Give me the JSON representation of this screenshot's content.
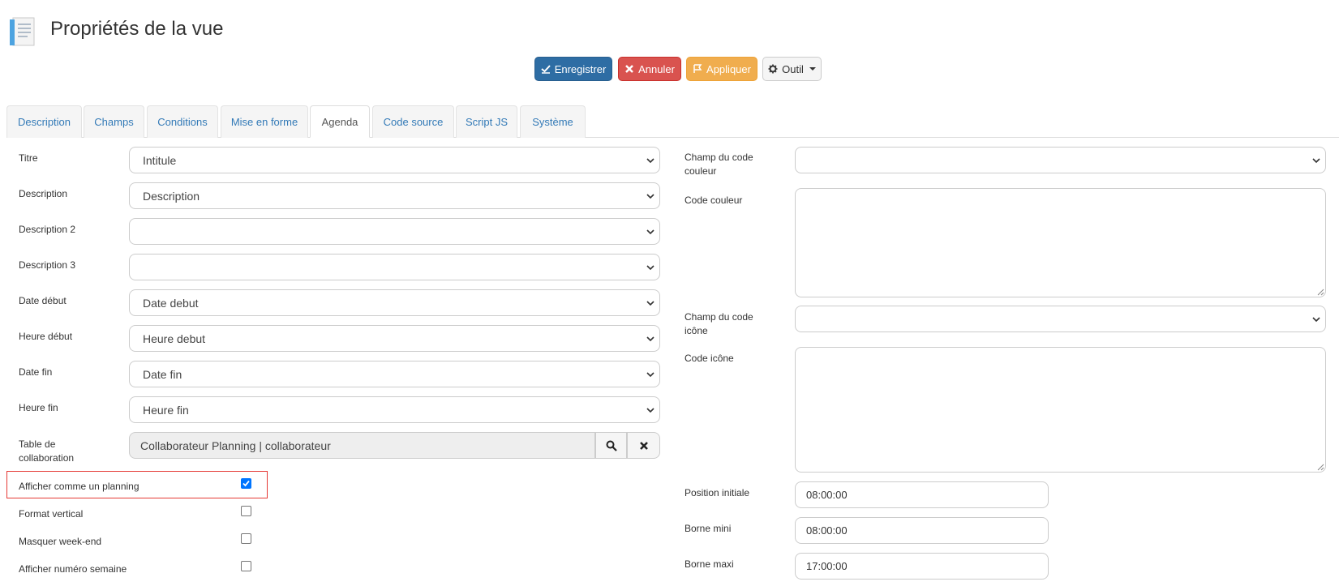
{
  "page": {
    "title": "Propriétés de la vue"
  },
  "toolbar": {
    "save_label": "Enregistrer",
    "cancel_label": "Annuler",
    "apply_label": "Appliquer",
    "tools_label": "Outil"
  },
  "tabs": [
    {
      "label": "Description",
      "active": false
    },
    {
      "label": "Champs",
      "active": false
    },
    {
      "label": "Conditions",
      "active": false
    },
    {
      "label": "Mise en forme",
      "active": false
    },
    {
      "label": "Agenda",
      "active": true
    },
    {
      "label": "Code source",
      "active": false
    },
    {
      "label": "Script JS",
      "active": false
    },
    {
      "label": "Système",
      "active": false
    }
  ],
  "left_fields": {
    "titre": {
      "label": "Titre",
      "value": "Intitule"
    },
    "description": {
      "label": "Description",
      "value": "Description"
    },
    "description2": {
      "label": "Description 2",
      "value": ""
    },
    "description3": {
      "label": "Description 3",
      "value": ""
    },
    "date_debut": {
      "label": "Date début",
      "value": "Date debut"
    },
    "heure_debut": {
      "label": "Heure début",
      "value": "Heure debut"
    },
    "date_fin": {
      "label": "Date fin",
      "value": "Date fin"
    },
    "heure_fin": {
      "label": "Heure fin",
      "value": "Heure fin"
    },
    "table_collab": {
      "label_line1": "Table de",
      "label_line2": "collaboration",
      "value": "Collaborateur Planning | collaborateur"
    }
  },
  "checkboxes": {
    "planning": {
      "label": "Afficher comme un planning",
      "checked": true
    },
    "vertical": {
      "label": "Format vertical",
      "checked": false
    },
    "weekend": {
      "label": "Masquer week-end",
      "checked": false
    },
    "week_number": {
      "label": "Afficher numéro semaine",
      "checked": false
    }
  },
  "right_fields": {
    "champ_couleur": {
      "label_line1": "Champ du code",
      "label_line2": "couleur",
      "value": ""
    },
    "code_couleur": {
      "label": "Code couleur",
      "value": ""
    },
    "champ_icone": {
      "label_line1": "Champ du code",
      "label_line2": "icône",
      "value": ""
    },
    "code_icone": {
      "label": "Code icône",
      "value": ""
    },
    "position_initiale": {
      "label": "Position initiale",
      "value": "08:00:00"
    },
    "borne_mini": {
      "label": "Borne mini",
      "value": "08:00:00"
    },
    "borne_maxi": {
      "label": "Borne maxi",
      "value": "17:00:00"
    }
  },
  "colors": {
    "primary": "#2e6da4",
    "danger": "#d9534f",
    "warning": "#f0ad4e",
    "link": "#337ab7",
    "highlight": "#e53935"
  },
  "icons": {
    "page": "document-icon",
    "save": "save-check-icon",
    "cancel": "close-icon",
    "apply": "flag-icon",
    "tools": "gear-icon",
    "search": "search-icon",
    "clear": "close-icon"
  }
}
